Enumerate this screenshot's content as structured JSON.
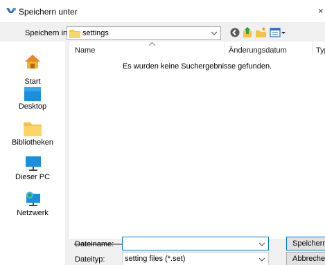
{
  "window": {
    "title": "Speichern unter"
  },
  "toolbar": {
    "save_in_label": "Speichern in:",
    "save_in_value": "settings",
    "icons": [
      "back-icon",
      "up-folder-icon",
      "new-folder-icon",
      "view-menu-icon"
    ]
  },
  "places": [
    {
      "label": "Start",
      "icon": "home-icon"
    },
    {
      "label": "Desktop",
      "icon": "desktop-icon"
    },
    {
      "label": "Bibliotheken",
      "icon": "libraries-icon"
    },
    {
      "label": "Dieser PC",
      "icon": "pc-icon"
    },
    {
      "label": "Netzwerk",
      "icon": "network-icon"
    }
  ],
  "filelist": {
    "columns": [
      "Name",
      "Änderungsdatum",
      "Typ"
    ],
    "empty_message": "Es wurden keine Suchergebnisse gefunden."
  },
  "form": {
    "filename_label": "Dateiname:",
    "filename_value": "",
    "filetype_label": "Dateityp:",
    "filetype_value": "setting files (*.set)"
  },
  "buttons": {
    "save": "Speichern",
    "cancel": "Abbrechen"
  },
  "colors": {
    "accent": "#0078d4",
    "folder": "#f8c846",
    "background": "#f0f0f0"
  }
}
